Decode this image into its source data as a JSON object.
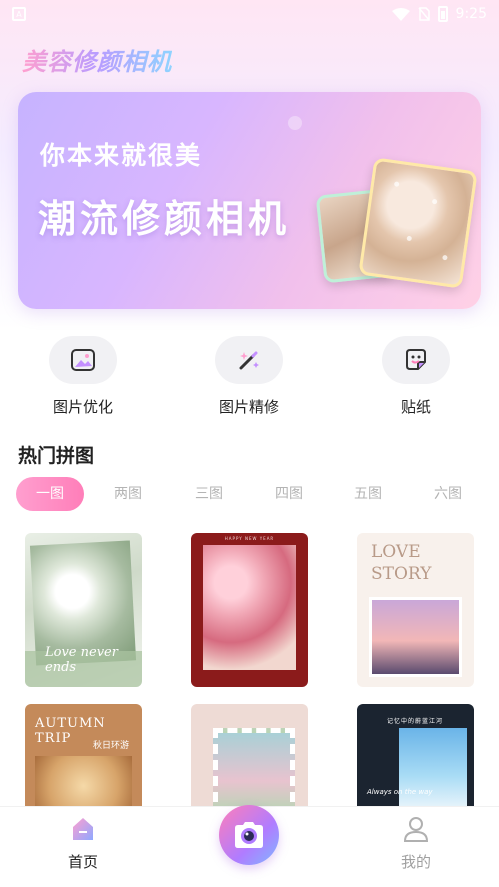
{
  "status_bar": {
    "time": "9:25"
  },
  "app_title": "美容修颜相机",
  "banner": {
    "subtitle": "你本来就很美",
    "title": "潮流修颜相机"
  },
  "quick_actions": [
    {
      "label": "图片优化",
      "icon": "image-enhance-icon"
    },
    {
      "label": "图片精修",
      "icon": "magic-wand-icon"
    },
    {
      "label": "贴纸",
      "icon": "sticker-icon"
    }
  ],
  "section": {
    "title": "热门拼图",
    "tabs": [
      "一图",
      "两图",
      "三图",
      "四图",
      "五图",
      "六图"
    ],
    "active_tab": "一图"
  },
  "templates": [
    {
      "text": "Love never ends"
    },
    {
      "text": "HAPPY NEW YEAR"
    },
    {
      "text": "LOVE STORY"
    },
    {
      "text": "AUTUMN TRIP",
      "subtext": "秋日环游"
    },
    {
      "text": ""
    },
    {
      "text": "记忆中的蔚蓝江河",
      "subtext": "Always on the way"
    }
  ],
  "bottom_nav": {
    "home_label": "首页",
    "mine_label": "我的"
  },
  "colors": {
    "accent_pink": "#ff7eb9",
    "accent_purple": "#b07cff"
  }
}
